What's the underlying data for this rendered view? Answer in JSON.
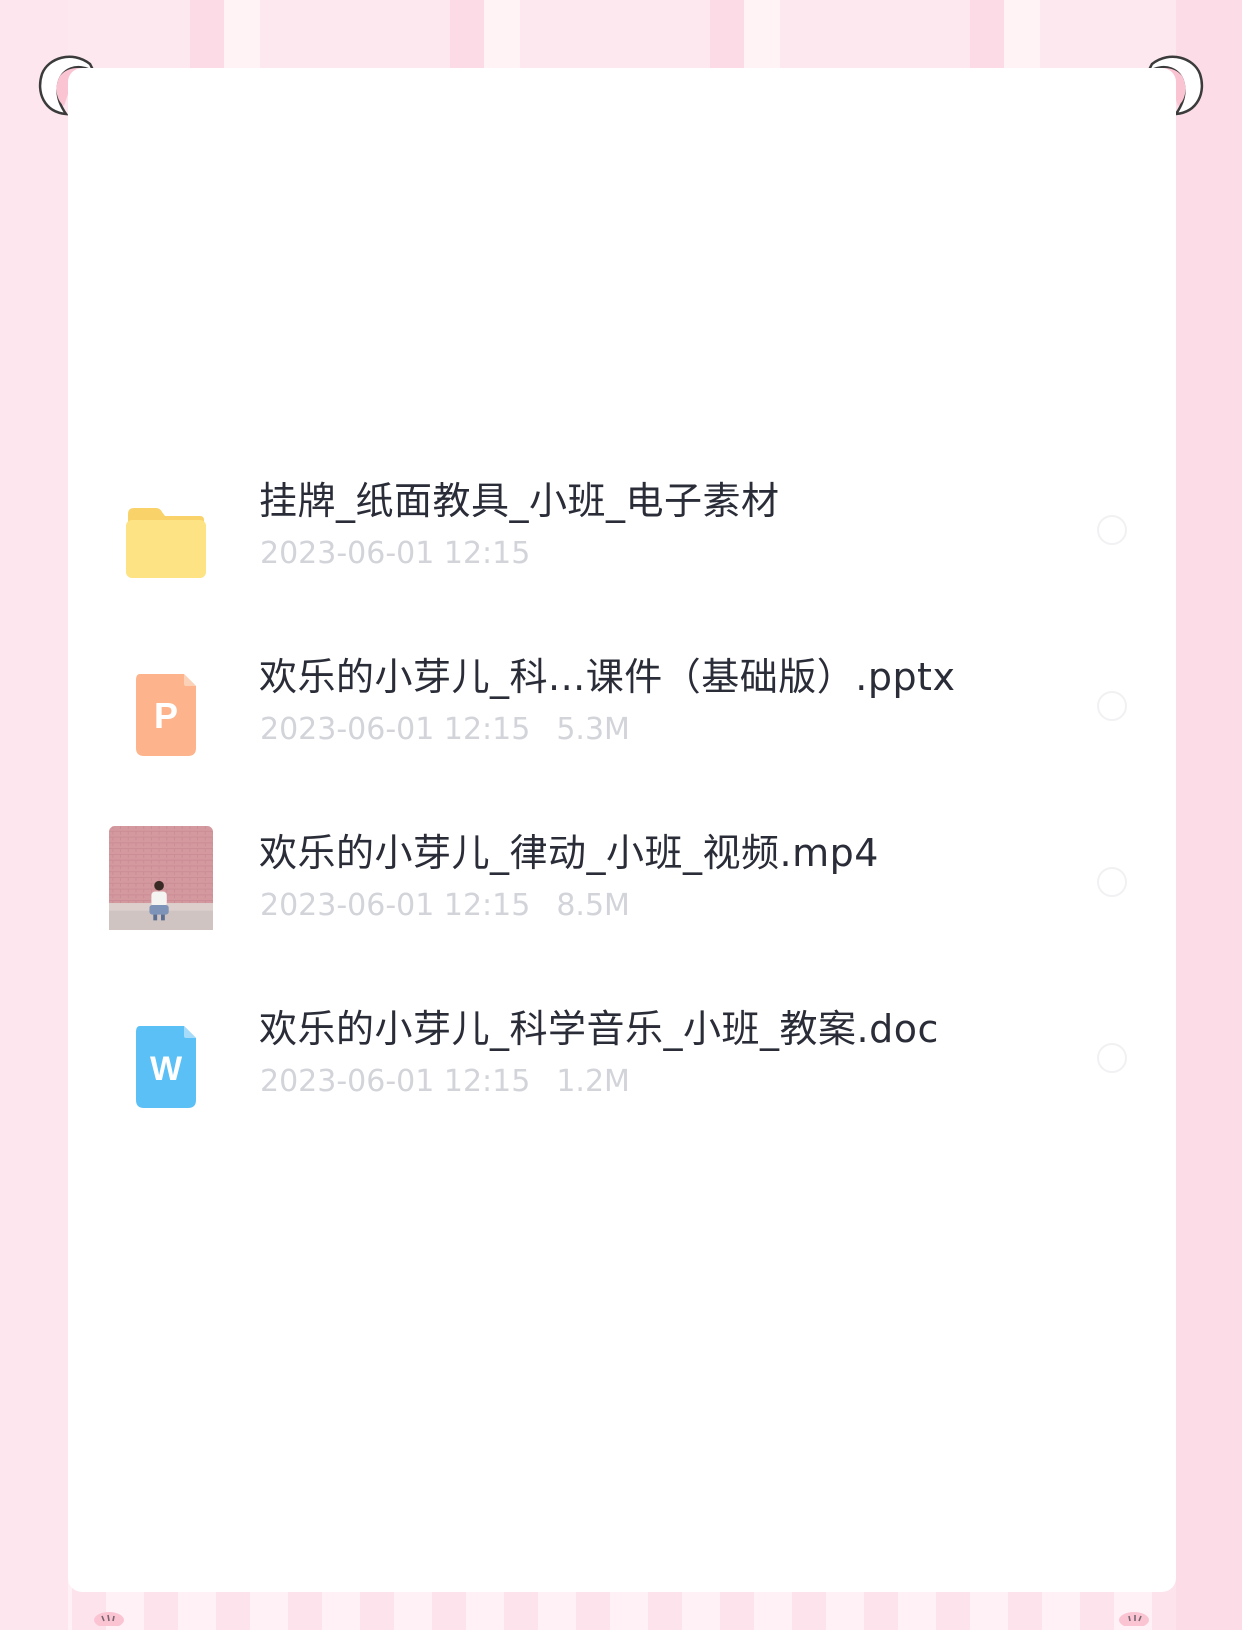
{
  "files": [
    {
      "name": "挂牌_纸面教具_小班_电子素材",
      "date": "2023-06-01 12:15",
      "size": "",
      "icon": "folder-icon"
    },
    {
      "name": "欢乐的小芽儿_科...课件（基础版）.pptx",
      "date": "2023-06-01 12:15",
      "size": "5.3M",
      "icon": "pptx-file-icon",
      "icon_letter": "P"
    },
    {
      "name": "欢乐的小芽儿_律动_小班_视频.mp4",
      "date": "2023-06-01 12:15",
      "size": "8.5M",
      "icon": "video-thumbnail"
    },
    {
      "name": "欢乐的小芽儿_科学音乐_小班_教案.doc",
      "date": "2023-06-01 12:15",
      "size": "1.2M",
      "icon": "doc-file-icon",
      "icon_letter": "W"
    }
  ],
  "colors": {
    "folder": "#fde383",
    "pptx": "#fdb38b",
    "doc": "#5bc0f5",
    "border_pink": "#fde3ec"
  }
}
